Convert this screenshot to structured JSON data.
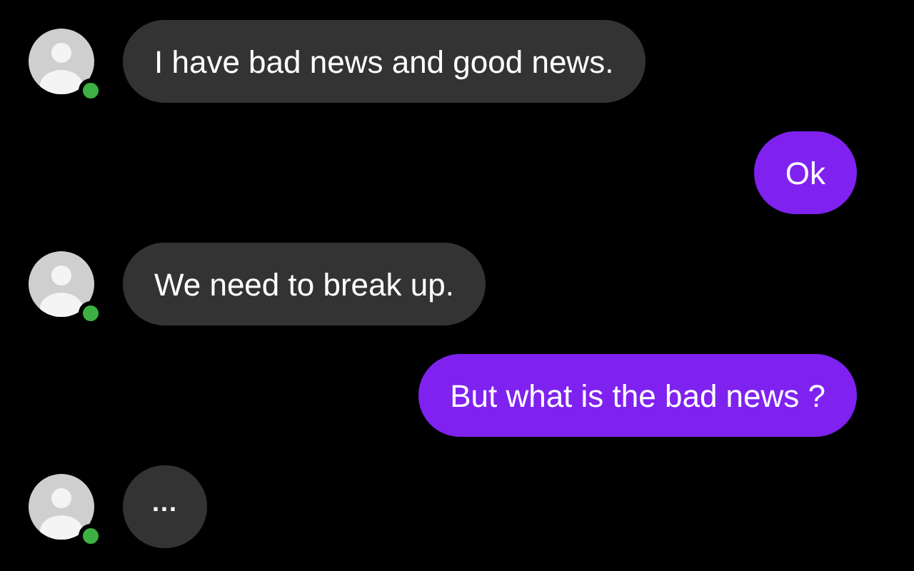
{
  "messages": [
    {
      "kind": "incoming",
      "text": "I have bad news and good news.",
      "online": true
    },
    {
      "kind": "outgoing",
      "text": "Ok"
    },
    {
      "kind": "incoming",
      "text": "We need to break up.",
      "online": true
    },
    {
      "kind": "outgoing",
      "text": "But what is the bad news ?"
    },
    {
      "kind": "typing",
      "text": "...",
      "online": true
    }
  ]
}
